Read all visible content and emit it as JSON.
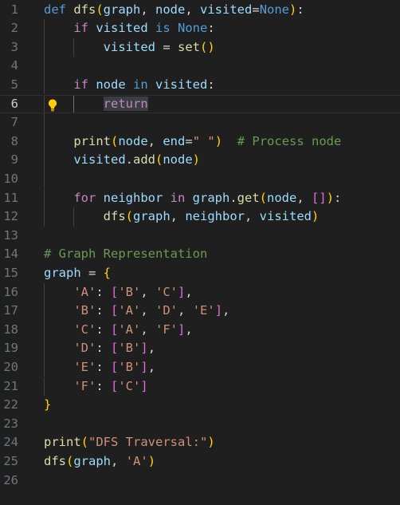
{
  "editor": {
    "language": "python",
    "current_line": 6,
    "lines": [
      {
        "n": "1",
        "tokens": [
          [
            "kw",
            "def "
          ],
          [
            "fn",
            "dfs"
          ],
          [
            "b1",
            "("
          ],
          [
            "var",
            "graph"
          ],
          [
            "op",
            ", "
          ],
          [
            "var",
            "node"
          ],
          [
            "op",
            ", "
          ],
          [
            "var",
            "visited"
          ],
          [
            "op",
            "="
          ],
          [
            "kw",
            "None"
          ],
          [
            "b1",
            ")"
          ],
          [
            "op",
            ":"
          ]
        ]
      },
      {
        "n": "2",
        "tokens": [
          [
            "op",
            "    "
          ],
          [
            "ctl",
            "if "
          ],
          [
            "var",
            "visited "
          ],
          [
            "kw",
            "is "
          ],
          [
            "kw",
            "None"
          ],
          [
            "op",
            ":"
          ]
        ]
      },
      {
        "n": "3",
        "tokens": [
          [
            "op",
            "        "
          ],
          [
            "var",
            "visited "
          ],
          [
            "op",
            "= "
          ],
          [
            "fn",
            "set"
          ],
          [
            "b1",
            "()"
          ]
        ]
      },
      {
        "n": "4",
        "tokens": []
      },
      {
        "n": "5",
        "tokens": [
          [
            "op",
            "    "
          ],
          [
            "ctl",
            "if "
          ],
          [
            "var",
            "node "
          ],
          [
            "kw",
            "in "
          ],
          [
            "var",
            "visited"
          ],
          [
            "op",
            ":"
          ]
        ]
      },
      {
        "n": "6",
        "tokens": [
          [
            "op",
            "        "
          ],
          [
            "ctl sel",
            "return"
          ]
        ]
      },
      {
        "n": "7",
        "tokens": []
      },
      {
        "n": "8",
        "tokens": [
          [
            "op",
            "    "
          ],
          [
            "fn",
            "print"
          ],
          [
            "b1",
            "("
          ],
          [
            "var",
            "node"
          ],
          [
            "op",
            ", "
          ],
          [
            "var",
            "end"
          ],
          [
            "op",
            "="
          ],
          [
            "str",
            "\" \""
          ],
          [
            "b1",
            ")"
          ],
          [
            "op",
            "  "
          ],
          [
            "cmt",
            "# Process node"
          ]
        ]
      },
      {
        "n": "9",
        "tokens": [
          [
            "op",
            "    "
          ],
          [
            "var",
            "visited"
          ],
          [
            "op",
            "."
          ],
          [
            "fn",
            "add"
          ],
          [
            "b1",
            "("
          ],
          [
            "var",
            "node"
          ],
          [
            "b1",
            ")"
          ]
        ]
      },
      {
        "n": "10",
        "tokens": []
      },
      {
        "n": "11",
        "tokens": [
          [
            "op",
            "    "
          ],
          [
            "ctl",
            "for "
          ],
          [
            "var",
            "neighbor "
          ],
          [
            "ctl",
            "in "
          ],
          [
            "var",
            "graph"
          ],
          [
            "op",
            "."
          ],
          [
            "fn",
            "get"
          ],
          [
            "b1",
            "("
          ],
          [
            "var",
            "node"
          ],
          [
            "op",
            ", "
          ],
          [
            "b2",
            "[]"
          ],
          [
            "b1",
            ")"
          ],
          [
            "op",
            ":"
          ]
        ]
      },
      {
        "n": "12",
        "tokens": [
          [
            "op",
            "        "
          ],
          [
            "fn",
            "dfs"
          ],
          [
            "b1",
            "("
          ],
          [
            "var",
            "graph"
          ],
          [
            "op",
            ", "
          ],
          [
            "var",
            "neighbor"
          ],
          [
            "op",
            ", "
          ],
          [
            "var",
            "visited"
          ],
          [
            "b1",
            ")"
          ]
        ]
      },
      {
        "n": "13",
        "tokens": []
      },
      {
        "n": "14",
        "tokens": [
          [
            "cmt",
            "# Graph Representation"
          ]
        ]
      },
      {
        "n": "15",
        "tokens": [
          [
            "var",
            "graph "
          ],
          [
            "op",
            "= "
          ],
          [
            "b1",
            "{"
          ]
        ]
      },
      {
        "n": "16",
        "tokens": [
          [
            "op",
            "    "
          ],
          [
            "str",
            "'A'"
          ],
          [
            "op",
            ": "
          ],
          [
            "b2",
            "["
          ],
          [
            "str",
            "'B'"
          ],
          [
            "op",
            ", "
          ],
          [
            "str",
            "'C'"
          ],
          [
            "b2",
            "]"
          ],
          [
            "op",
            ","
          ]
        ]
      },
      {
        "n": "17",
        "tokens": [
          [
            "op",
            "    "
          ],
          [
            "str",
            "'B'"
          ],
          [
            "op",
            ": "
          ],
          [
            "b2",
            "["
          ],
          [
            "str",
            "'A'"
          ],
          [
            "op",
            ", "
          ],
          [
            "str",
            "'D'"
          ],
          [
            "op",
            ", "
          ],
          [
            "str",
            "'E'"
          ],
          [
            "b2",
            "]"
          ],
          [
            "op",
            ","
          ]
        ]
      },
      {
        "n": "18",
        "tokens": [
          [
            "op",
            "    "
          ],
          [
            "str",
            "'C'"
          ],
          [
            "op",
            ": "
          ],
          [
            "b2",
            "["
          ],
          [
            "str",
            "'A'"
          ],
          [
            "op",
            ", "
          ],
          [
            "str",
            "'F'"
          ],
          [
            "b2",
            "]"
          ],
          [
            "op",
            ","
          ]
        ]
      },
      {
        "n": "19",
        "tokens": [
          [
            "op",
            "    "
          ],
          [
            "str",
            "'D'"
          ],
          [
            "op",
            ": "
          ],
          [
            "b2",
            "["
          ],
          [
            "str",
            "'B'"
          ],
          [
            "b2",
            "]"
          ],
          [
            "op",
            ","
          ]
        ]
      },
      {
        "n": "20",
        "tokens": [
          [
            "op",
            "    "
          ],
          [
            "str",
            "'E'"
          ],
          [
            "op",
            ": "
          ],
          [
            "b2",
            "["
          ],
          [
            "str",
            "'B'"
          ],
          [
            "b2",
            "]"
          ],
          [
            "op",
            ","
          ]
        ]
      },
      {
        "n": "21",
        "tokens": [
          [
            "op",
            "    "
          ],
          [
            "str",
            "'F'"
          ],
          [
            "op",
            ": "
          ],
          [
            "b2",
            "["
          ],
          [
            "str",
            "'C'"
          ],
          [
            "b2",
            "]"
          ]
        ]
      },
      {
        "n": "22",
        "tokens": [
          [
            "b1",
            "}"
          ]
        ]
      },
      {
        "n": "23",
        "tokens": []
      },
      {
        "n": "24",
        "tokens": [
          [
            "fn",
            "print"
          ],
          [
            "b1",
            "("
          ],
          [
            "str",
            "\"DFS Traversal:\""
          ],
          [
            "b1",
            ")"
          ]
        ]
      },
      {
        "n": "25",
        "tokens": [
          [
            "fn",
            "dfs"
          ],
          [
            "b1",
            "("
          ],
          [
            "var",
            "graph"
          ],
          [
            "op",
            ", "
          ],
          [
            "str",
            "'A'"
          ],
          [
            "b1",
            ")"
          ]
        ]
      },
      {
        "n": "26",
        "tokens": []
      }
    ]
  },
  "icons": {
    "lightbulb": "lightbulb-icon",
    "bulb_color": "#ffcc00"
  }
}
